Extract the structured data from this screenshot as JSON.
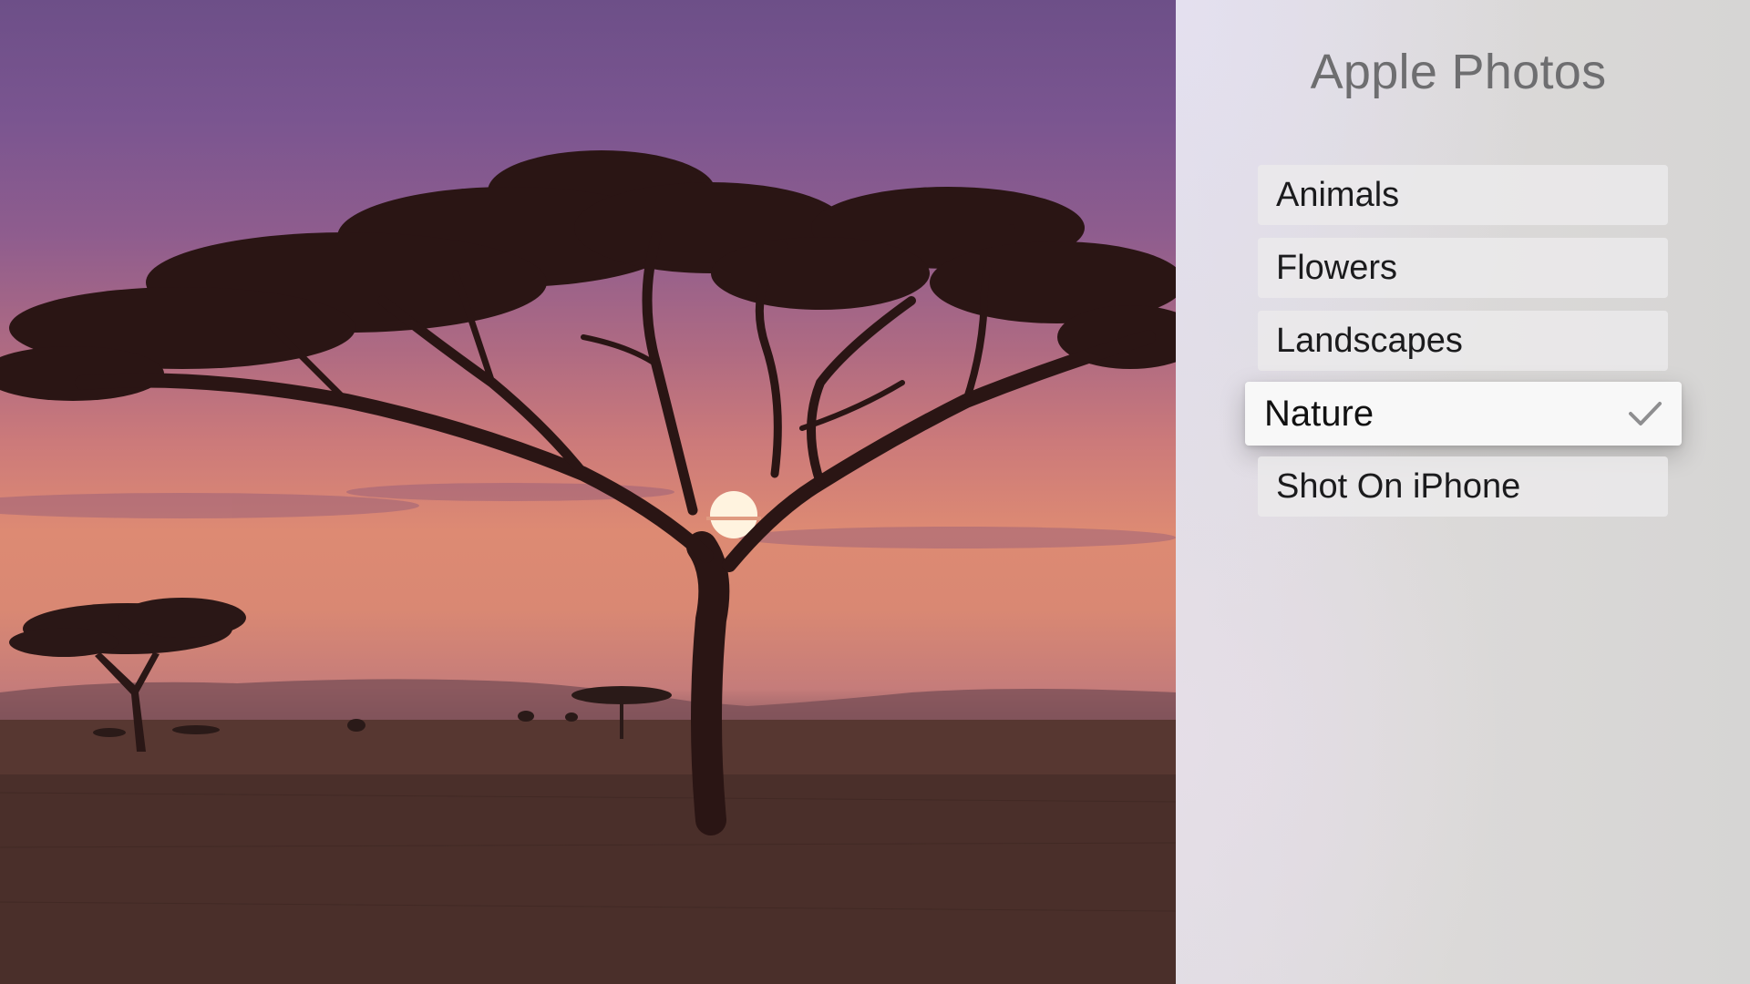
{
  "preview": {
    "image": "acacia-tree-sunset-savanna-photo"
  },
  "panel": {
    "title": "Apple Photos",
    "items": [
      {
        "label": "Animals",
        "selected": false
      },
      {
        "label": "Flowers",
        "selected": false
      },
      {
        "label": "Landscapes",
        "selected": false
      },
      {
        "label": "Nature",
        "selected": true,
        "icon": "checkmark-icon"
      },
      {
        "label": "Shot On iPhone",
        "selected": false
      }
    ]
  },
  "colors": {
    "panel_background": "#dcdad9",
    "title_text": "#6e6e70",
    "item_background": "#ebeaeb",
    "focused_item_background": "#f8f8f8",
    "checkmark": "#8e8e90"
  }
}
